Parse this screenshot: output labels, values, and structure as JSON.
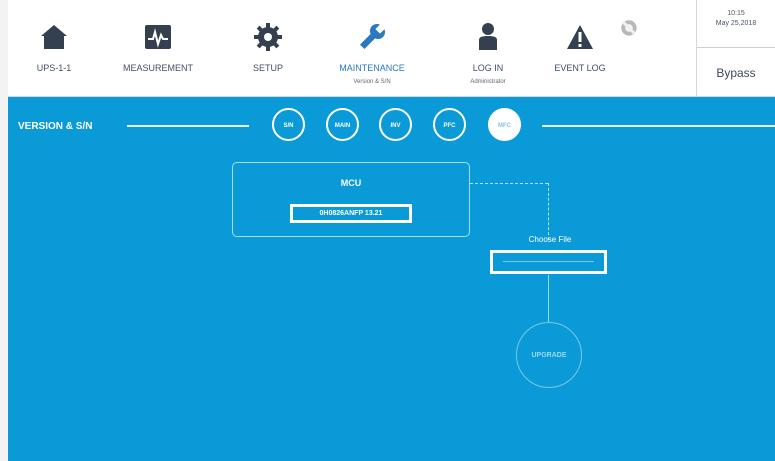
{
  "nav": {
    "items": [
      {
        "label": "UPS-1-1",
        "sublabel": "",
        "icon": "home-icon"
      },
      {
        "label": "MEASUREMENT",
        "sublabel": "",
        "icon": "pulse-icon"
      },
      {
        "label": "SETUP",
        "sublabel": "",
        "icon": "gear-icon"
      },
      {
        "label": "MAINTENANCE",
        "sublabel": "Version & S/N",
        "icon": "wrench-icon"
      },
      {
        "label": "LOG IN",
        "sublabel": "Administrator",
        "icon": "user-icon"
      },
      {
        "label": "EVENT LOG",
        "sublabel": "",
        "icon": "warning-icon"
      },
      {
        "label": "",
        "sublabel": "",
        "icon": "mute-icon"
      }
    ]
  },
  "status": {
    "time": "10:15",
    "date": "May 25,2018",
    "mode": "Bypass"
  },
  "page": {
    "title": "VERSION & S/N"
  },
  "tabs": [
    "S/N",
    "MAIN",
    "INV",
    "PFC",
    "MFC"
  ],
  "mcu": {
    "title": "MCU",
    "firmware": "0H0826ANFP 13.21"
  },
  "upload": {
    "choose_label": "Choose File",
    "upgrade_label": "UPGRADE"
  },
  "colors": {
    "background": "#0b9ad8",
    "active_nav": "#2a79c0"
  }
}
